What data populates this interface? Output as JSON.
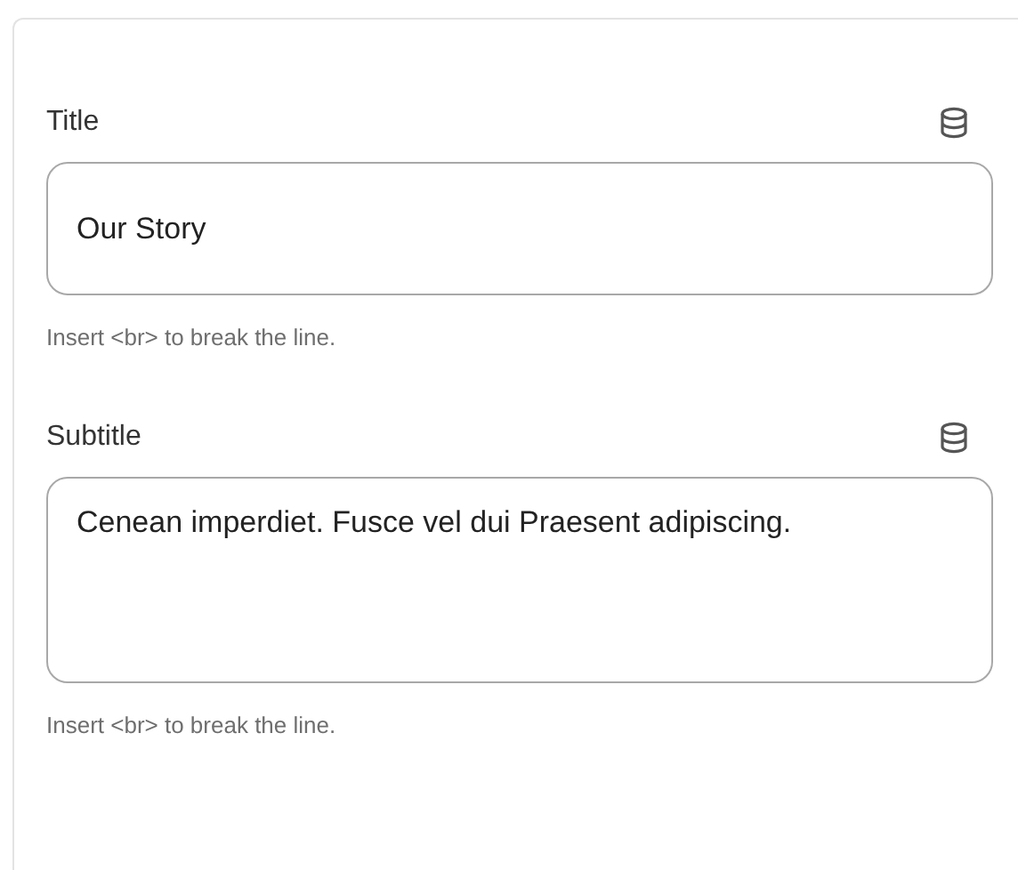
{
  "fields": [
    {
      "kind": "input",
      "label": "Title",
      "value": "Our Story",
      "hint": "Insert <br> to break the line."
    },
    {
      "kind": "textarea",
      "label": "Subtitle",
      "value": "Cenean imperdiet. Fusce vel dui Praesent adipiscing.",
      "hint": "Insert <br> to break the line."
    }
  ]
}
